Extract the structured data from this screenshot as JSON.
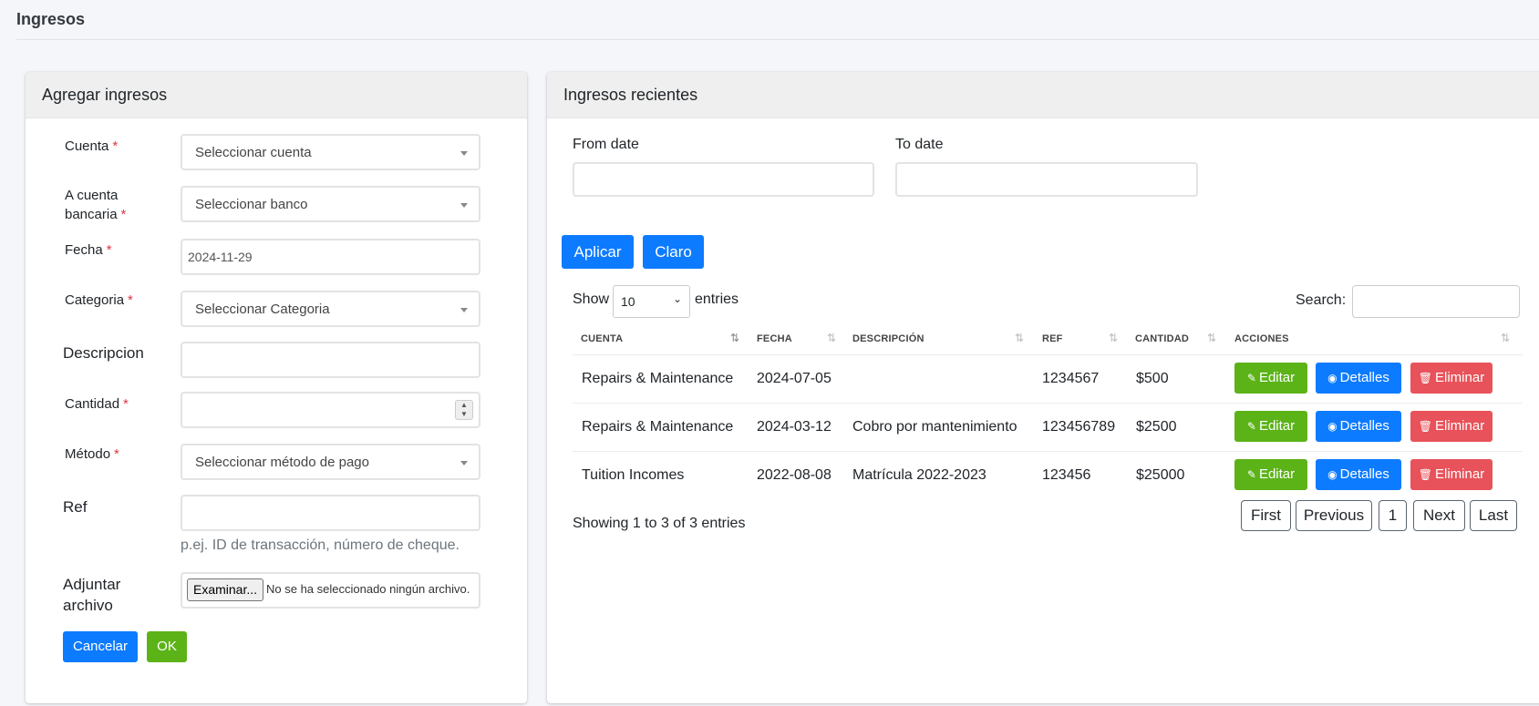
{
  "page": {
    "title": "Ingresos"
  },
  "form": {
    "title": "Agregar ingresos",
    "account_label": "Cuenta",
    "account_placeholder": "Seleccionar cuenta",
    "bank_label_line1": "A cuenta",
    "bank_label_line2": "bancaria",
    "bank_placeholder": "Seleccionar banco",
    "date_label": "Fecha",
    "date_value": "2024-11-29",
    "category_label": "Categoria",
    "category_placeholder": "Seleccionar Categoria",
    "description_label": "Descripcion",
    "amount_label": "Cantidad",
    "method_label": "Método",
    "method_placeholder": "Seleccionar método de pago",
    "ref_label": "Ref",
    "ref_hint": "p.ej. ID de transacción, número de cheque.",
    "attach_label_line1": "Adjuntar",
    "attach_label_line2": "archivo",
    "file_button": "Examinar...",
    "file_none": "No se ha seleccionado ningún archivo.",
    "required_mark": "*",
    "cancel_button": "Cancelar",
    "ok_button": "OK"
  },
  "recent": {
    "title": "Ingresos recientes",
    "from_label": "From date",
    "to_label": "To date",
    "apply_button": "Aplicar",
    "clear_button": "Claro",
    "show_label": "Show",
    "entries_label": "entries",
    "page_length": "10",
    "search_label": "Search:",
    "columns": [
      "CUENTA",
      "FECHA",
      "DESCRIPCIÓN",
      "REF",
      "CANTIDAD",
      "ACCIONES"
    ],
    "rows": [
      {
        "cuenta": "Repairs & Maintenance",
        "fecha": "2024-07-05",
        "descripcion": "",
        "ref": "1234567",
        "cantidad": "$500"
      },
      {
        "cuenta": "Repairs & Maintenance",
        "fecha": "2024-03-12",
        "descripcion": "Cobro por mantenimiento",
        "ref": "123456789",
        "cantidad": "$2500"
      },
      {
        "cuenta": "Tuition Incomes",
        "fecha": "2022-08-08",
        "descripcion": "Matrícula 2022-2023",
        "ref": "123456",
        "cantidad": "$25000"
      }
    ],
    "action_edit": "Editar",
    "action_details": "Detalles",
    "action_delete": "Eliminar",
    "info": "Showing 1 to 3 of 3 entries",
    "pagination": {
      "first": "First",
      "previous": "Previous",
      "current": "1",
      "next": "Next",
      "last": "Last"
    }
  },
  "colors": {
    "primary": "#0d7bff",
    "success": "#5bb318",
    "danger": "#e8525a",
    "required": "#dc3545"
  },
  "icons": {
    "edit": "edit-icon",
    "view": "eye-icon",
    "delete": "trash-icon",
    "sort": "sort-icon"
  }
}
